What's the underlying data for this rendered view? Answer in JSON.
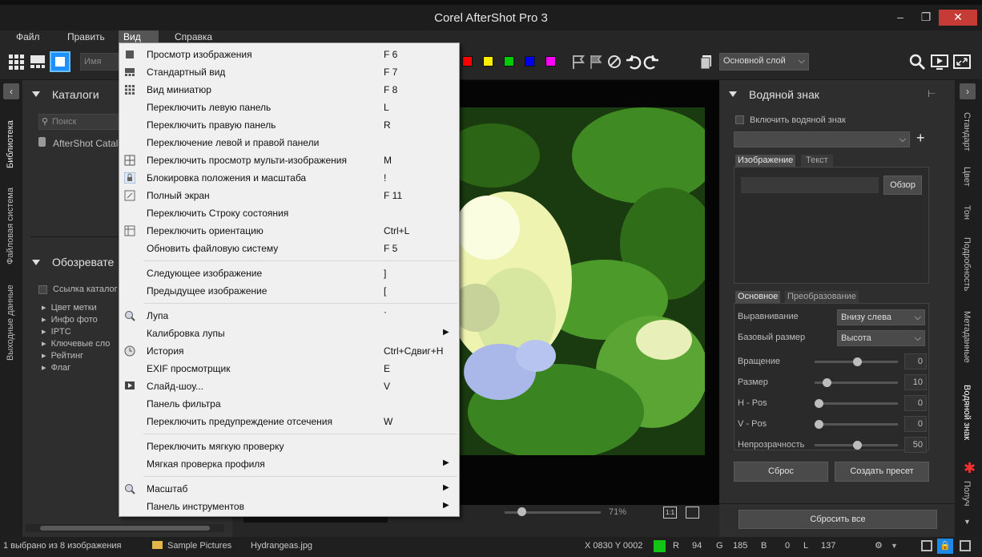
{
  "window": {
    "title": "Corel AfterShot Pro 3",
    "minimize": "–",
    "maximize": "❐",
    "close": "✕"
  },
  "menubar": [
    {
      "label": "Файл"
    },
    {
      "label": "Править"
    },
    {
      "label": "Вид"
    },
    {
      "label": "Справка"
    }
  ],
  "toolbar": {
    "sort_placeholder": "Имя",
    "layer_select": "Основной слой",
    "colors": [
      "#ff0000",
      "#ffee00",
      "#00cc00",
      "#0000ee",
      "#ff00ff"
    ]
  },
  "left_tabs": [
    "Библиотека",
    "Файловая система",
    "Выходные данные"
  ],
  "catalogs": {
    "title": "Каталоги",
    "search_placeholder": "Поиск",
    "item": "AfterShot Catal"
  },
  "browser": {
    "title": "Обозревате",
    "catalog_link": "Ссылка каталог",
    "items": [
      "Цвет метки",
      "Инфо фото",
      "IPTC",
      "Ключевые сло",
      "Рейтинг",
      "Флаг"
    ]
  },
  "center": {
    "zoom": "71%"
  },
  "view_menu": {
    "groups": [
      [
        {
          "label": "Просмотр изображения",
          "key": "F 6",
          "icon": "single-view-icon"
        },
        {
          "label": "Стандартный вид",
          "key": "F 7",
          "icon": "standard-view-icon"
        },
        {
          "label": "Вид миниатюр",
          "key": "F 8",
          "icon": "thumbnail-view-icon"
        },
        {
          "label": "Переключить левую панель",
          "key": "L"
        },
        {
          "label": "Переключить правую панель",
          "key": "R"
        },
        {
          "label": "Переключение левой и правой панели",
          "key": ""
        },
        {
          "label": "Переключить просмотр мульти-изображения",
          "key": "M",
          "icon": "multi-image-icon"
        },
        {
          "label": "Блокировка положения и масштаба",
          "key": "!",
          "icon": "lock-icon"
        },
        {
          "label": "Полный экран",
          "key": "F 11",
          "icon": "fullscreen-icon"
        },
        {
          "label": "Переключить Строку состояния",
          "key": ""
        },
        {
          "label": "Переключить ориентацию",
          "key": "Ctrl+L",
          "icon": "orientation-icon"
        },
        {
          "label": "Обновить файловую систему",
          "key": "F 5"
        }
      ],
      [
        {
          "label": "Следующее изображение",
          "key": "]"
        },
        {
          "label": "Предыдущее изображение",
          "key": "["
        }
      ],
      [
        {
          "label": "Лупа",
          "key": "`",
          "icon": "loupe-icon"
        },
        {
          "label": "Калибровка лупы",
          "key": "",
          "submenu": true
        },
        {
          "label": "История",
          "key": "Ctrl+Сдвиг+H",
          "icon": "history-icon"
        },
        {
          "label": "EXIF просмотрщик",
          "key": "E"
        },
        {
          "label": "Слайд-шоу...",
          "key": "V",
          "icon": "slideshow-icon"
        },
        {
          "label": "Панель фильтра",
          "key": ""
        },
        {
          "label": "Переключить предупреждение отсечения",
          "key": "W"
        }
      ],
      [
        {
          "label": "Переключить мягкую проверку",
          "key": ""
        },
        {
          "label": "Мягкая проверка профиля",
          "key": "",
          "submenu": true
        }
      ],
      [
        {
          "label": "Масштаб",
          "key": "",
          "submenu": true,
          "icon": "zoom-icon"
        },
        {
          "label": "Панель инструментов",
          "key": "",
          "submenu": true
        }
      ]
    ]
  },
  "watermark": {
    "title": "Водяной знак",
    "enable_label": "Включить водяной знак",
    "tabs_top": [
      "Изображение",
      "Текст"
    ],
    "browse_button": "Обзор",
    "tabs_bottom": [
      "Основное",
      "Преобразование"
    ],
    "alignment_label": "Выравнивание",
    "alignment_value": "Внизу слева",
    "base_size_label": "Базовый размер",
    "base_size_value": "Высота",
    "sliders": [
      {
        "label": "Вращение",
        "value": "0",
        "fraction": 0.5
      },
      {
        "label": "Размер",
        "value": "10",
        "fraction": 0.1
      },
      {
        "label": "H - Pos",
        "value": "0",
        "fraction": 0.0
      },
      {
        "label": "V - Pos",
        "value": "0",
        "fraction": 0.0
      },
      {
        "label": "Непрозрачность",
        "value": "50",
        "fraction": 0.5
      }
    ],
    "reset_button": "Сброс",
    "preset_button": "Создать пресет",
    "reset_all_button": "Сбросить все"
  },
  "right_tabs": [
    "Стандарт",
    "Цвет",
    "Тон",
    "Подробность",
    "Метаданные",
    "Водяной знак",
    "Получ"
  ],
  "status": {
    "selection": "1 выбрано из 8 изображения",
    "folder": "Sample Pictures",
    "file": "Hydrangeas.jpg",
    "coords": "X 0830  Y 0002",
    "r_label": "R",
    "r_value": "94",
    "g_label": "G",
    "g_value": "185",
    "b_label": "B",
    "b_value": "0",
    "l_label": "L",
    "l_value": "137"
  }
}
